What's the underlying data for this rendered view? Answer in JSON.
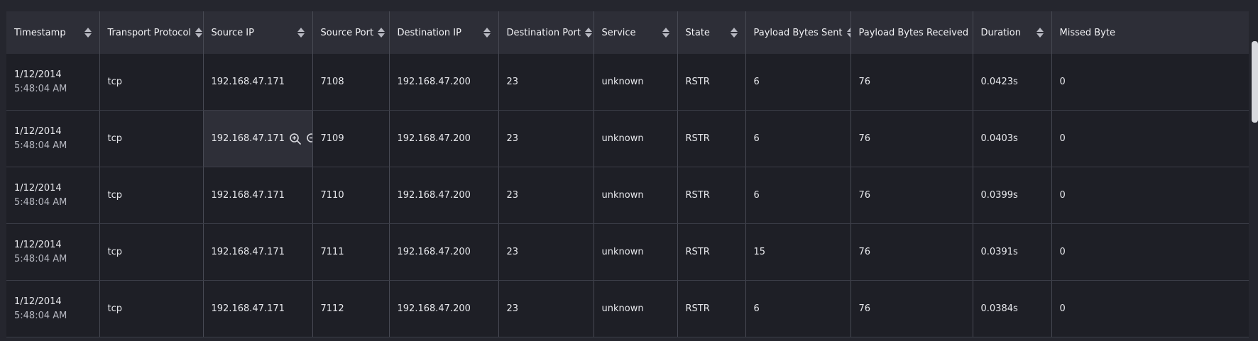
{
  "columns": [
    {
      "label": "Timestamp"
    },
    {
      "label": "Transport Protocol"
    },
    {
      "label": "Source IP"
    },
    {
      "label": "Source Port"
    },
    {
      "label": "Destination IP"
    },
    {
      "label": "Destination Port"
    },
    {
      "label": "Service"
    },
    {
      "label": "State"
    },
    {
      "label": "Payload Bytes Sent"
    },
    {
      "label": "Payload Bytes Received"
    },
    {
      "label": "Duration"
    },
    {
      "label": "Missed Byte"
    }
  ],
  "rows": [
    {
      "date": "1/12/2014",
      "time": "5:48:04 AM",
      "protocol": "tcp",
      "source_ip": "192.168.47.171",
      "source_port": "7108",
      "dest_ip": "192.168.47.200",
      "dest_port": "23",
      "service": "unknown",
      "state": "RSTR",
      "bytes_sent": "6",
      "bytes_received": "76",
      "duration": "0.0423s",
      "missed": "0"
    },
    {
      "date": "1/12/2014",
      "time": "5:48:04 AM",
      "protocol": "tcp",
      "source_ip": "192.168.47.171",
      "source_port": "7109",
      "dest_ip": "192.168.47.200",
      "dest_port": "23",
      "service": "unknown",
      "state": "RSTR",
      "bytes_sent": "6",
      "bytes_received": "76",
      "duration": "0.0403s",
      "missed": "0"
    },
    {
      "date": "1/12/2014",
      "time": "5:48:04 AM",
      "protocol": "tcp",
      "source_ip": "192.168.47.171",
      "source_port": "7110",
      "dest_ip": "192.168.47.200",
      "dest_port": "23",
      "service": "unknown",
      "state": "RSTR",
      "bytes_sent": "6",
      "bytes_received": "76",
      "duration": "0.0399s",
      "missed": "0"
    },
    {
      "date": "1/12/2014",
      "time": "5:48:04 AM",
      "protocol": "tcp",
      "source_ip": "192.168.47.171",
      "source_port": "7111",
      "dest_ip": "192.168.47.200",
      "dest_port": "23",
      "service": "unknown",
      "state": "RSTR",
      "bytes_sent": "15",
      "bytes_received": "76",
      "duration": "0.0391s",
      "missed": "0"
    },
    {
      "date": "1/12/2014",
      "time": "5:48:04 AM",
      "protocol": "tcp",
      "source_ip": "192.168.47.171",
      "source_port": "7112",
      "dest_ip": "192.168.47.200",
      "dest_port": "23",
      "service": "unknown",
      "state": "RSTR",
      "bytes_sent": "6",
      "bytes_received": "76",
      "duration": "0.0384s",
      "missed": "0"
    }
  ],
  "hover_actions": {
    "row_index": 1,
    "icons": [
      "zoom-in-icon",
      "zoom-out-icon"
    ]
  },
  "colors": {
    "background": "#25262e",
    "header_bg": "#2d2e37",
    "row_bg": "#1e1f26",
    "hover_bg": "#2e2f38",
    "grid_line": "#474953"
  }
}
